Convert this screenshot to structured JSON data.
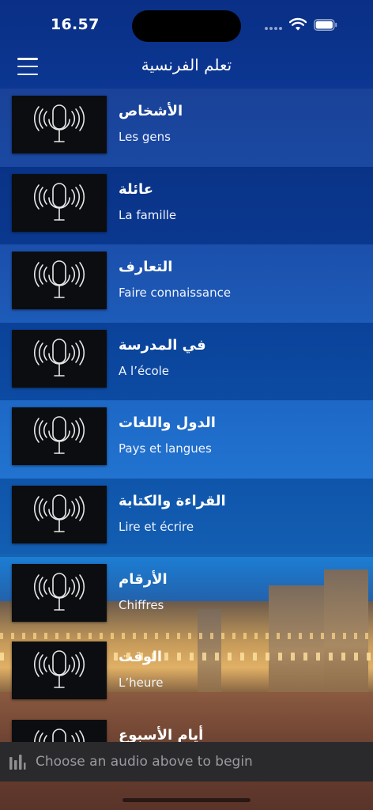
{
  "status_bar": {
    "time": "16.57"
  },
  "nav": {
    "title": "تعلم الفرنسية",
    "menu_icon": "hamburger-menu-icon"
  },
  "lessons": [
    {
      "ar": "الأشخاص",
      "fr": "Les gens"
    },
    {
      "ar": "عائلة",
      "fr": "La famille"
    },
    {
      "ar": "التعارف",
      "fr": "Faire connaissance"
    },
    {
      "ar": "في المدرسة",
      "fr": "A l’école"
    },
    {
      "ar": "الدول واللغات",
      "fr": "Pays et langues"
    },
    {
      "ar": "القراءة والكتابة",
      "fr": "Lire et écrire"
    },
    {
      "ar": "الأرقام",
      "fr": "Chiffres"
    },
    {
      "ar": "الوقت",
      "fr": "L’heure"
    },
    {
      "ar": "أيام الأسبوع",
      "fr": ""
    }
  ],
  "lesson_icon": "microphone-broadcast-icon",
  "player": {
    "prompt": "Choose an audio above to begin",
    "icon": "audio-bars-icon"
  }
}
